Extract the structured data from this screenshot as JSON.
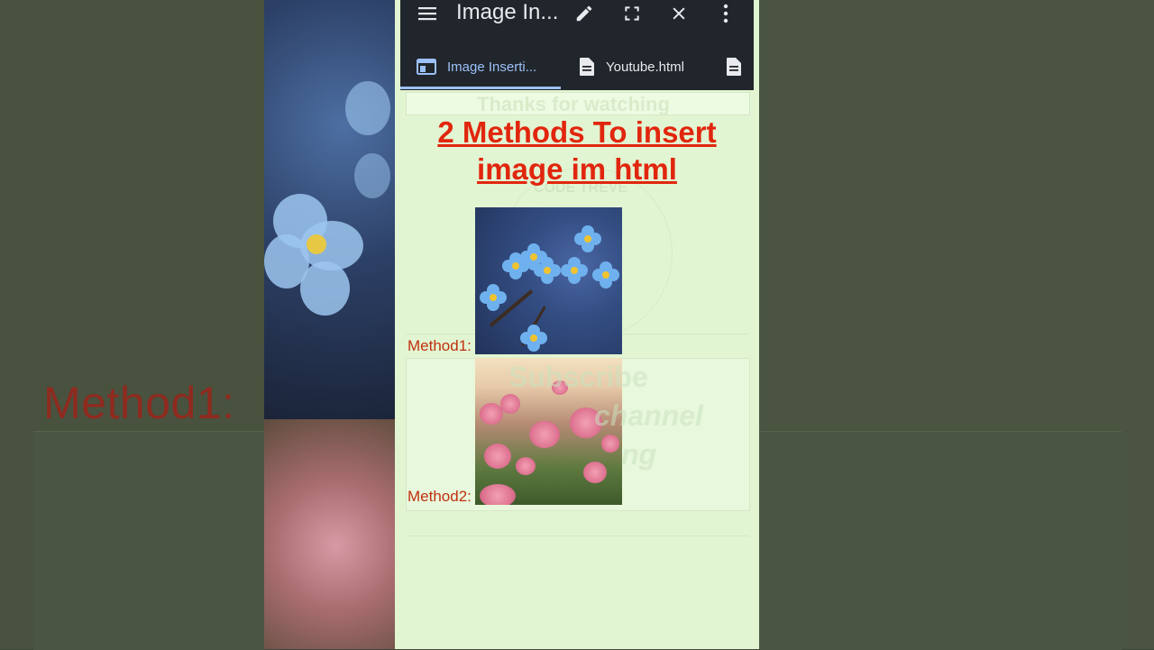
{
  "app": {
    "title": "Image In...",
    "icons": {
      "menu": "menu-icon",
      "edit": "pencil-icon",
      "fullscreen": "fullscreen-icon",
      "close": "close-icon",
      "more": "more-vert-icon"
    }
  },
  "tabs": [
    {
      "label": "Image Inserti...",
      "icon": "web-page-icon",
      "active": true
    },
    {
      "label": "Youtube.html",
      "icon": "document-icon",
      "active": false
    },
    {
      "label": "",
      "icon": "document-icon",
      "active": false
    }
  ],
  "page": {
    "ghost_banner": "Thanks for watching",
    "heading_line1": "2 Methods To insert",
    "heading_line2": "image im html",
    "ghost_sub": "CODE TREVE",
    "methods": [
      {
        "label": "Method1:",
        "image": "blue-forget-me-not-flowers"
      },
      {
        "label": "Method2:",
        "image": "pink-peony-flowers"
      }
    ],
    "ghost_overlay": [
      "Subscribe",
      "channel",
      "ng"
    ]
  },
  "background": {
    "method_text": "Method1:"
  },
  "colors": {
    "heading": "#e1260e",
    "method_label": "#c0300f",
    "page_bg": "#e2f5d2",
    "topbar_bg": "#20262b",
    "active_tab": "#9cc0f9"
  }
}
